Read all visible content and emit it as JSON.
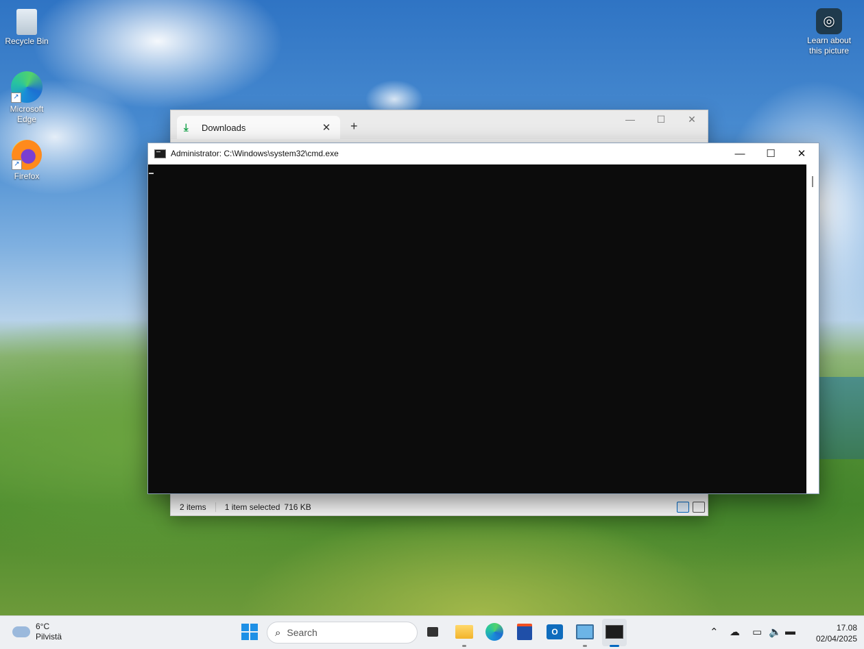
{
  "desktop": {
    "icons": [
      {
        "label": "Recycle Bin"
      },
      {
        "label_line1": "Microsoft",
        "label_line2": "Edge"
      },
      {
        "label": "Firefox"
      }
    ],
    "learn": {
      "line1": "Learn about",
      "line2": "this picture"
    }
  },
  "explorer": {
    "tab_label": "Downloads",
    "new_tab": "+",
    "status": {
      "items": "2 items",
      "selected": "1 item selected",
      "size": "716 KB"
    }
  },
  "cmd": {
    "title": "Administrator: C:\\Windows\\system32\\cmd.exe"
  },
  "taskbar": {
    "weather_temp": "6°C",
    "weather_desc": "Pilvistä",
    "search_placeholder": "Search",
    "time": "17.08",
    "date": "02/04/2025"
  },
  "colors": {
    "accent": "#0067c0",
    "console_bg": "#0c0c0c",
    "taskbar_bg": "#eef0f3"
  }
}
